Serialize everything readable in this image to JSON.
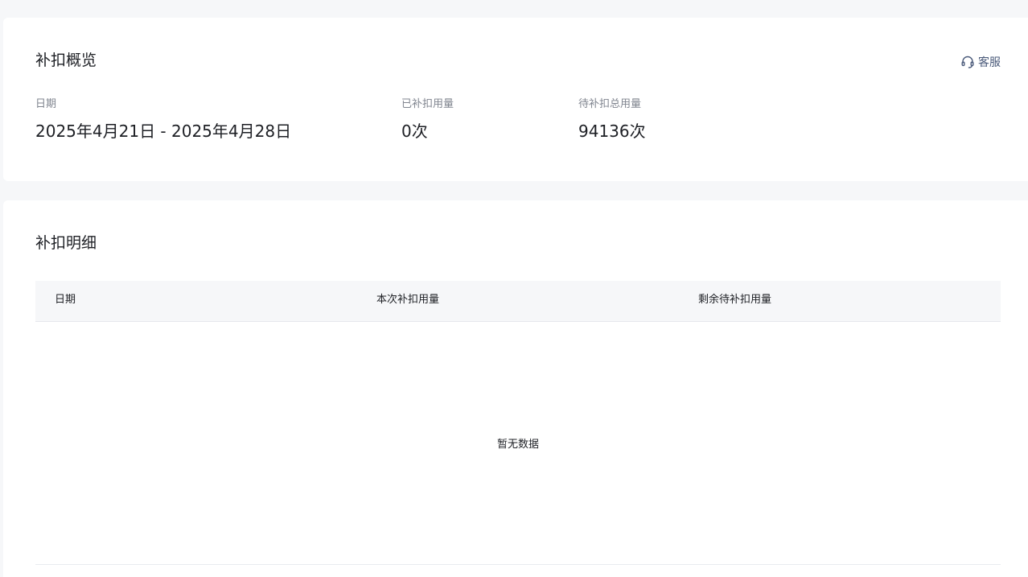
{
  "overview": {
    "title": "补扣概览",
    "support_label": "客服",
    "stats": {
      "date_label": "日期",
      "date_value": "2025年4月21日 - 2025年4月28日",
      "used_label": "已补扣用量",
      "used_value": "0次",
      "pending_label": "待补扣总用量",
      "pending_value": "94136次"
    }
  },
  "detail": {
    "title": "补扣明细",
    "columns": [
      "日期",
      "本次补扣用量",
      "剩余待补扣用量"
    ],
    "rows": [],
    "empty_text": "暂无数据"
  },
  "icons": {
    "support": "headset-icon"
  },
  "colors": {
    "page_background": "#f6f7f9",
    "card_background": "#ffffff",
    "support_link": "#4a5a7a",
    "table_header_background": "#f6f7f9"
  }
}
